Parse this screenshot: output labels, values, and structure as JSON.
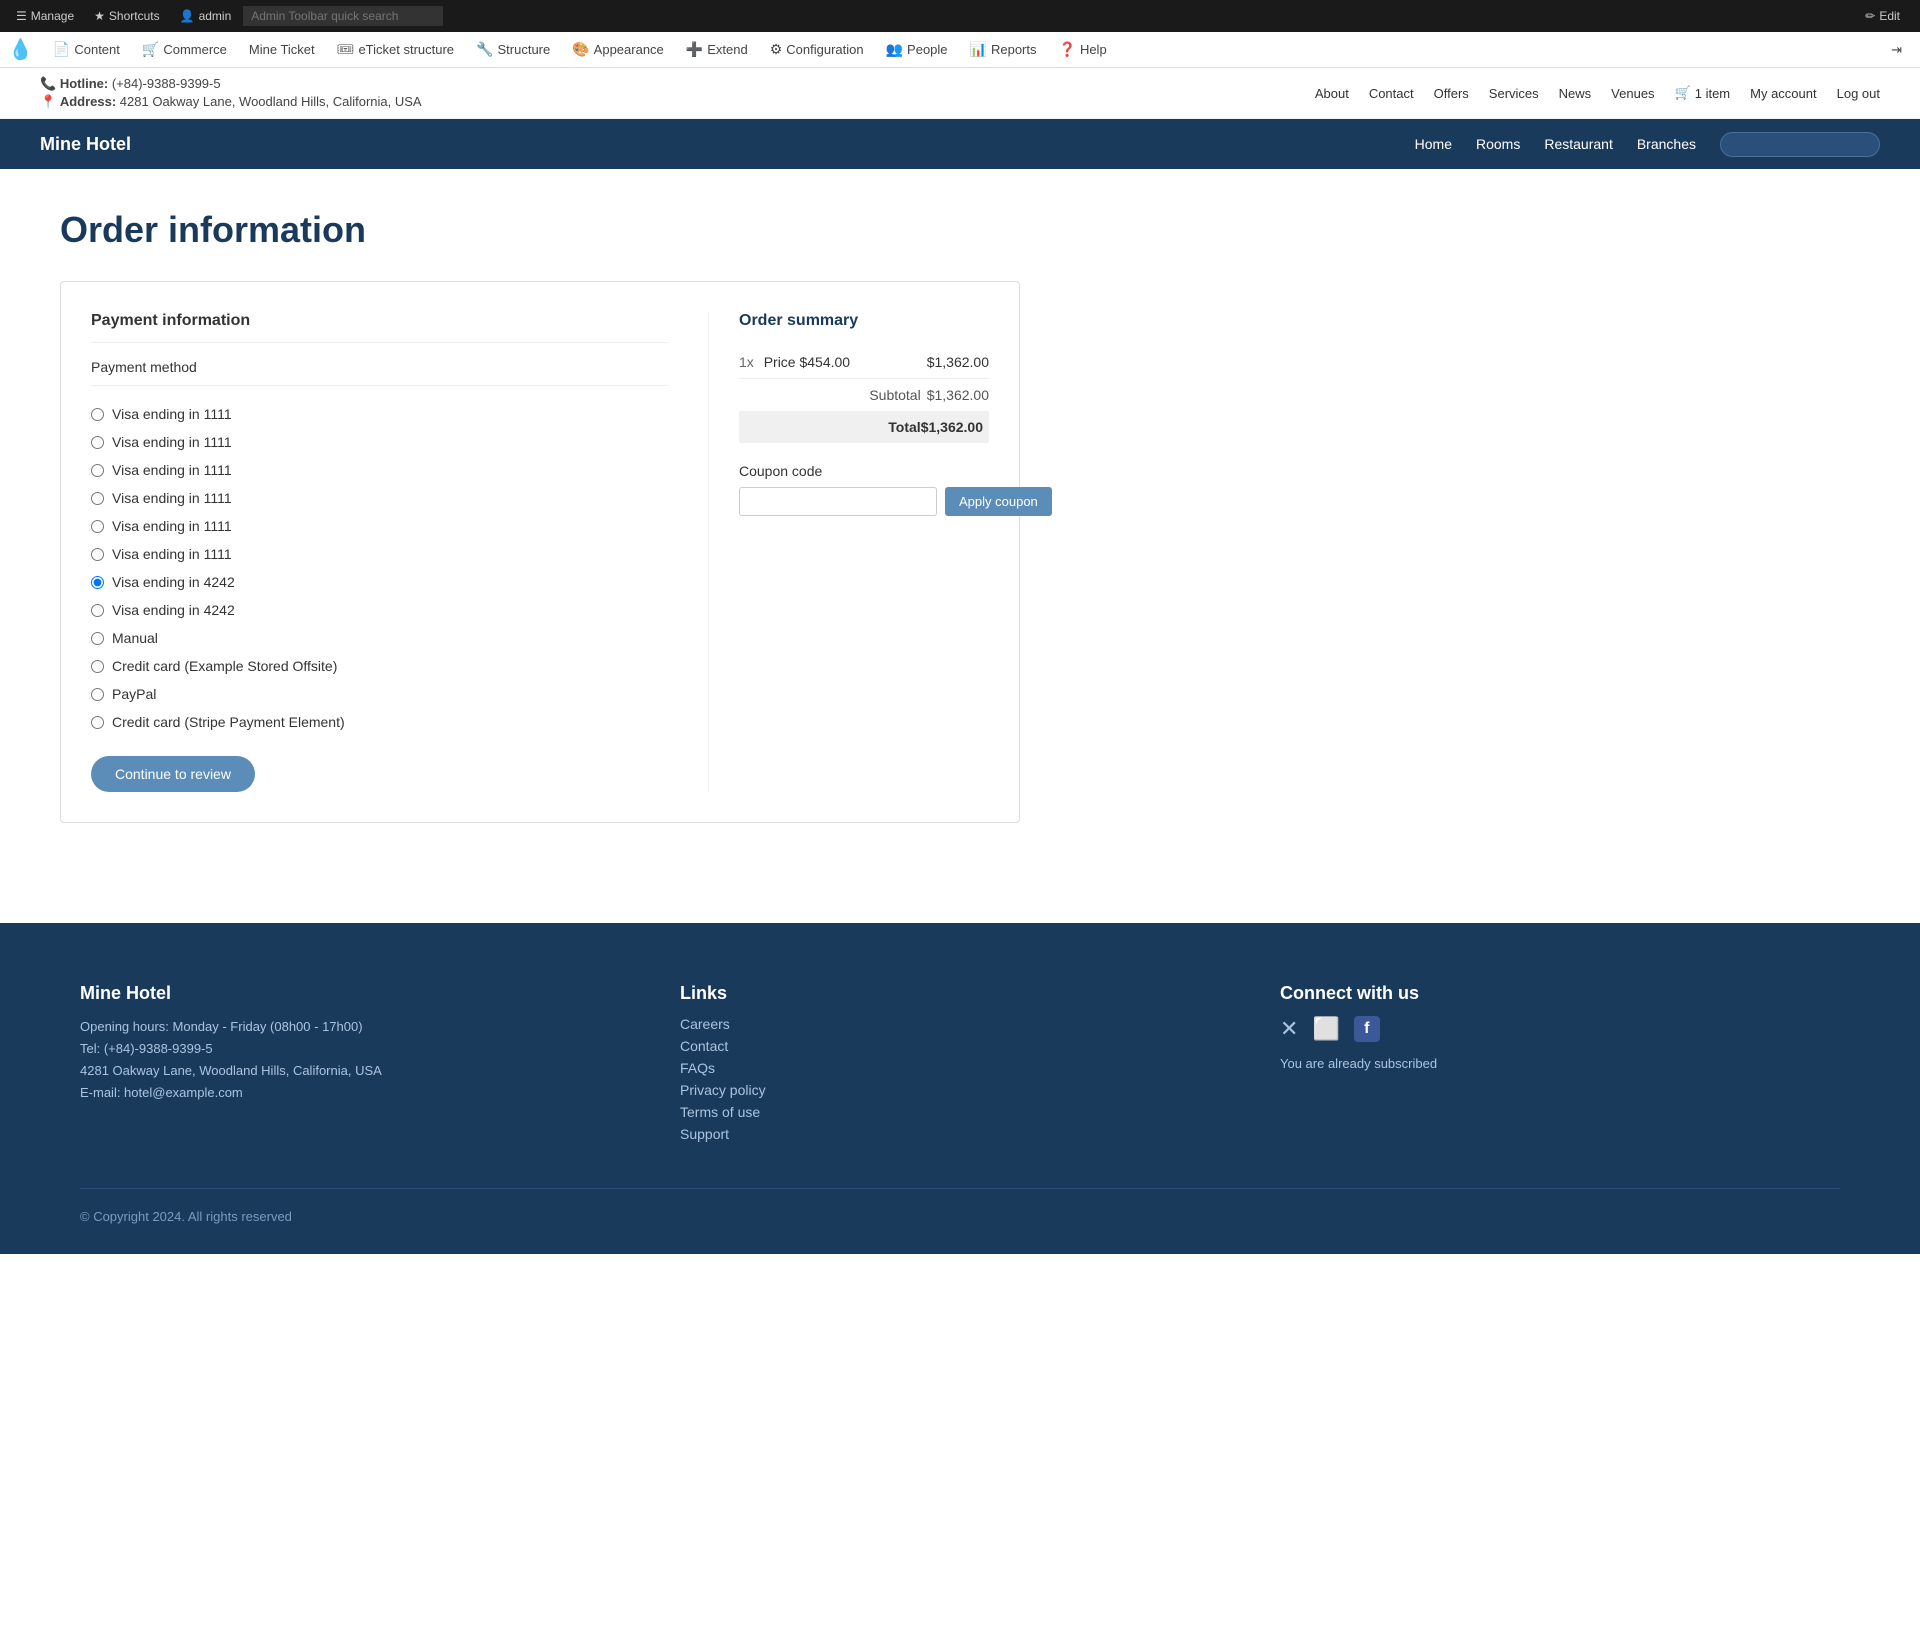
{
  "admin_toolbar": {
    "manage_label": "Manage",
    "shortcuts_label": "Shortcuts",
    "admin_label": "admin",
    "search_placeholder": "Admin Toolbar quick search",
    "edit_label": "Edit"
  },
  "drupal_nav": {
    "items": [
      {
        "id": "content",
        "icon": "📄",
        "label": "Content"
      },
      {
        "id": "commerce",
        "icon": "🛒",
        "label": "Commerce"
      },
      {
        "id": "mine-ticket",
        "icon": "",
        "label": "Mine Ticket"
      },
      {
        "id": "eticket-structure",
        "icon": "",
        "label": "eTicket structure"
      },
      {
        "id": "structure",
        "icon": "🔧",
        "label": "Structure"
      },
      {
        "id": "appearance",
        "icon": "🎨",
        "label": "Appearance"
      },
      {
        "id": "extend",
        "icon": "➕",
        "label": "Extend"
      },
      {
        "id": "configuration",
        "icon": "⚙",
        "label": "Configuration"
      },
      {
        "id": "people",
        "icon": "👥",
        "label": "People"
      },
      {
        "id": "reports",
        "icon": "📊",
        "label": "Reports"
      },
      {
        "id": "help",
        "icon": "❓",
        "label": "Help"
      }
    ]
  },
  "site_info": {
    "hotline_label": "Hotline:",
    "hotline_number": "(+84)-9388-9399-5",
    "address_label": "Address:",
    "address_text": "4281 Oakway Lane, Woodland Hills, California, USA",
    "nav_links": [
      "About",
      "Contact",
      "Offers",
      "Services",
      "News",
      "Venues"
    ],
    "cart_label": "1 item",
    "my_account_label": "My account",
    "logout_label": "Log out"
  },
  "site_nav": {
    "brand": "Mine Hotel",
    "links": [
      "Home",
      "Rooms",
      "Restaurant",
      "Branches"
    ],
    "search_placeholder": ""
  },
  "page": {
    "title": "Order information"
  },
  "payment": {
    "section_title": "Payment information",
    "method_label": "Payment method",
    "options": [
      {
        "id": "visa-1111-a",
        "label": "Visa ending in 1111",
        "checked": false
      },
      {
        "id": "visa-1111-b",
        "label": "Visa ending in 1111",
        "checked": false
      },
      {
        "id": "visa-1111-c",
        "label": "Visa ending in 1111",
        "checked": false
      },
      {
        "id": "visa-1111-d",
        "label": "Visa ending in 1111",
        "checked": false
      },
      {
        "id": "visa-1111-e",
        "label": "Visa ending in 1111",
        "checked": false
      },
      {
        "id": "visa-1111-f",
        "label": "Visa ending in 1111",
        "checked": false
      },
      {
        "id": "visa-4242-a",
        "label": "Visa ending in 4242",
        "checked": true
      },
      {
        "id": "visa-4242-b",
        "label": "Visa ending in 4242",
        "checked": false
      },
      {
        "id": "manual",
        "label": "Manual",
        "checked": false
      },
      {
        "id": "credit-offsite",
        "label": "Credit card (Example Stored Offsite)",
        "checked": false
      },
      {
        "id": "paypal",
        "label": "PayPal",
        "checked": false
      },
      {
        "id": "credit-stripe",
        "label": "Credit card (Stripe Payment Element)",
        "checked": false
      }
    ],
    "continue_button": "Continue to review"
  },
  "order_summary": {
    "title": "Order summary",
    "quantity": "1x",
    "price_label": "Price $454.00",
    "amount": "$1,362.00",
    "subtotal_label": "Subtotal",
    "subtotal_value": "$1,362.00",
    "total_label": "Total",
    "total_value": "$1,362.00",
    "coupon_label": "Coupon code",
    "coupon_placeholder": "",
    "apply_button": "Apply coupon"
  },
  "footer": {
    "brand": "Mine Hotel",
    "opening_hours": "Opening hours: Monday - Friday (08h00 - 17h00)",
    "tel": "Tel: (+84)-9388-9399-5",
    "address": "4281 Oakway Lane, Woodland Hills, California, USA",
    "email": "E-mail: hotel@example.com",
    "links_title": "Links",
    "links": [
      "Careers",
      "Contact",
      "FAQs",
      "Privacy policy",
      "Terms of use",
      "Support"
    ],
    "connect_title": "Connect with us",
    "social_icons": [
      {
        "id": "x-icon",
        "symbol": "𝕏"
      },
      {
        "id": "instagram-icon",
        "symbol": "📷"
      },
      {
        "id": "facebook-icon",
        "symbol": "f"
      }
    ],
    "subscribed_text": "You are already subscribed",
    "copyright": "© Copyright 2024. All rights reserved"
  }
}
